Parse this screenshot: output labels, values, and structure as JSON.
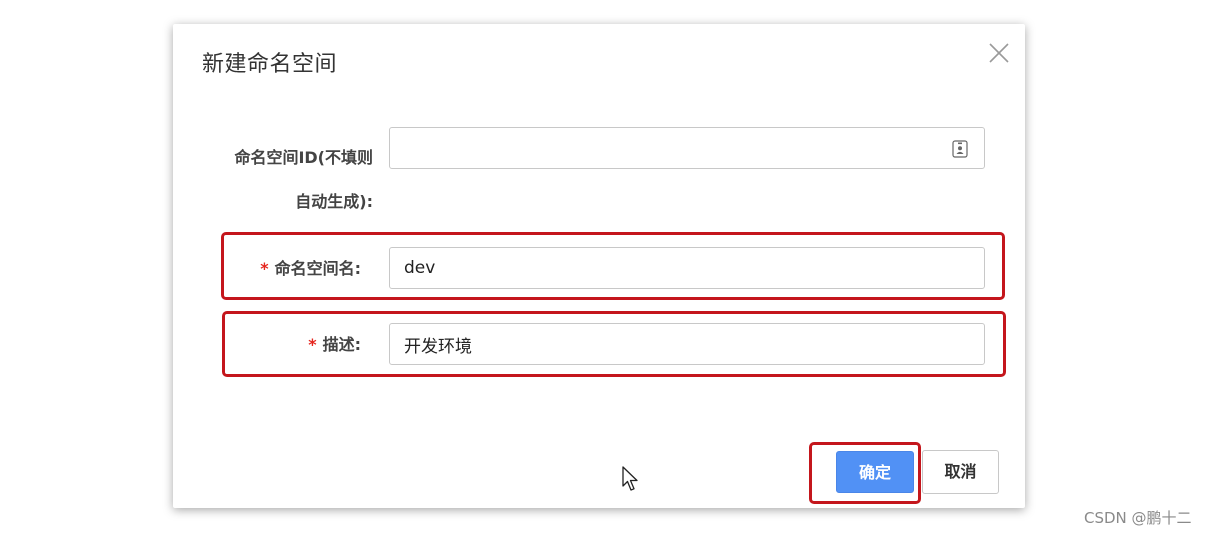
{
  "dialog": {
    "title": "新建命名空间",
    "close_icon": "close-icon"
  },
  "form": {
    "namespace_id": {
      "label_line1": "命名空间ID(不填则",
      "label_line2": "自动生成):",
      "value": "",
      "icon": "contact-card-icon"
    },
    "namespace_name": {
      "required_mark": "*",
      "label": "命名空间名:",
      "value": "dev"
    },
    "description": {
      "required_mark": "*",
      "label": "描述:",
      "value": "开发环境"
    }
  },
  "buttons": {
    "confirm_label": "确定",
    "cancel_label": "取消"
  },
  "watermark": "CSDN @鹏十二",
  "colors": {
    "primary": "#5191f5",
    "required": "#e5261f",
    "annotation_highlight": "#c4161c"
  }
}
